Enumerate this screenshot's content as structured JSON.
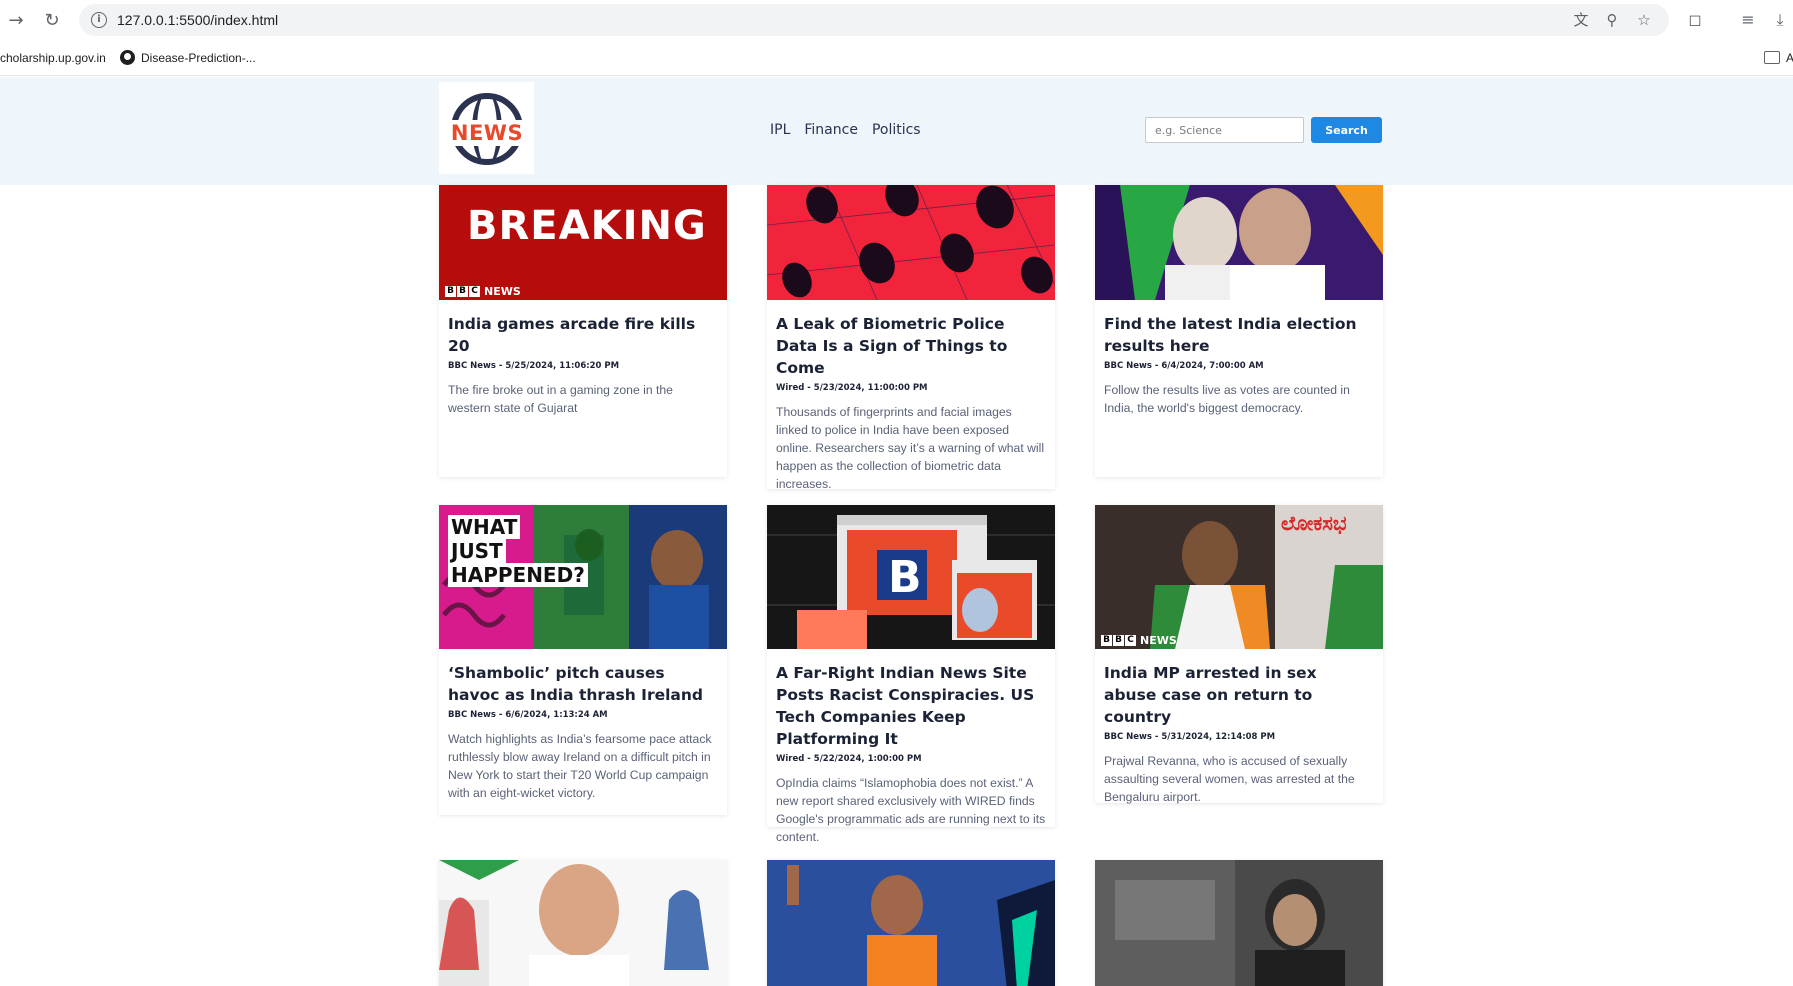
{
  "browser": {
    "url": "127.0.0.1:5500/index.html",
    "bookmarks": [
      {
        "label": "cholarship.up.gov.in"
      },
      {
        "label": "Disease-Prediction-..."
      }
    ],
    "bookmark_truncated": "A"
  },
  "site": {
    "logo_text": "NEWS",
    "nav": [
      "IPL",
      "Finance",
      "Politics"
    ],
    "search": {
      "placeholder": "e.g. Science",
      "button_label": "Search"
    }
  },
  "image_text": {
    "breaking": "BREAKING",
    "bbc_letters": [
      "B",
      "B",
      "C"
    ],
    "bbc_news": "NEWS",
    "what_just_happened": [
      "WHAT",
      "JUST",
      "HAPPENED?"
    ],
    "kannada": "ಲೋಕಸಭ"
  },
  "articles": [
    {
      "title": "India games arcade fire kills 20",
      "meta": "BBC News - 5/25/2024, 11:06:20 PM",
      "description": "The fire broke out in a gaming zone in the western state of Gujarat"
    },
    {
      "title": "A Leak of Biometric Police Data Is a Sign of Things to Come",
      "meta": "Wired - 5/23/2024, 11:00:00 PM",
      "description": "Thousands of fingerprints and facial images linked to police in India have been exposed online. Researchers say it’s a warning of what will happen as the collection of biometric data increases."
    },
    {
      "title": "Find the latest India election results here",
      "meta": "BBC News - 6/4/2024, 7:00:00 AM",
      "description": "Follow the results live as votes are counted in India, the world's biggest democracy."
    },
    {
      "title": "‘Shambolic’ pitch causes havoc as India thrash Ireland",
      "meta": "BBC News - 6/6/2024, 1:13:24 AM",
      "description": "Watch highlights as India’s fearsome pace attack ruthlessly blow away Ireland on a difficult pitch in New York to start their T20 World Cup campaign with an eight-wicket victory."
    },
    {
      "title": "A Far-Right Indian News Site Posts Racist Conspiracies. US Tech Companies Keep Platforming It",
      "meta": "Wired - 5/22/2024, 1:00:00 PM",
      "description": "OpIndia claims “Islamophobia does not exist.” A new report shared exclusively with WIRED finds Google's programmatic ads are running next to its content."
    },
    {
      "title": "India MP arrested in sex abuse case on return to country",
      "meta": "BBC News - 5/31/2024, 12:14:08 PM",
      "description": "Prajwal Revanna, who is accused of sexually assaulting several women, was arrested at the Bengaluru airport."
    },
    {
      "title": "",
      "meta": "",
      "description": ""
    },
    {
      "title": "",
      "meta": "",
      "description": ""
    },
    {
      "title": "",
      "meta": "",
      "description": ""
    }
  ],
  "colors": {
    "header_bg": "#eef5fb",
    "search_button": "#1e88e5",
    "logo_red": "#e8492b",
    "logo_navy": "#2c3350"
  }
}
